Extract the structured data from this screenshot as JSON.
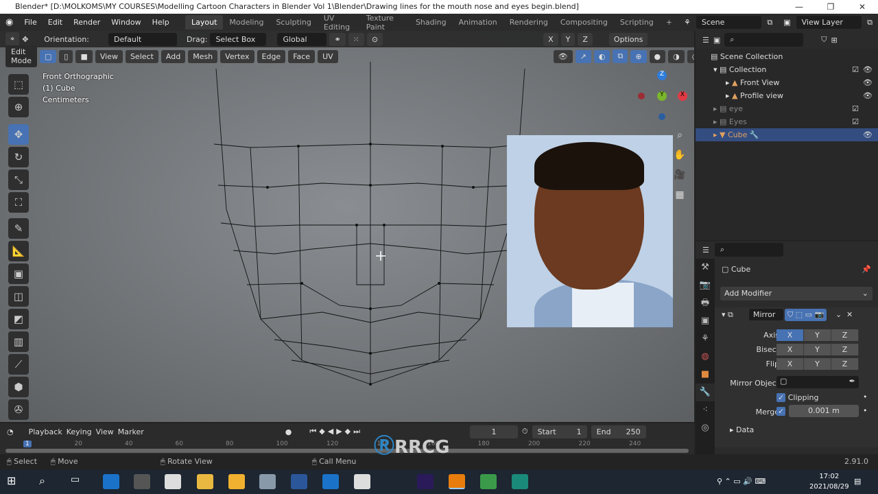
{
  "window": {
    "title": "Blender* [D:\\MOLKOMS\\MY COURSES\\Modelling  Cartoon Characters in Blender Vol 1\\Blender\\Drawing lines for the mouth nose and eyes begin.blend]"
  },
  "menu": [
    "File",
    "Edit",
    "Render",
    "Window",
    "Help"
  ],
  "workspaces": [
    "Layout",
    "Modeling",
    "Sculpting",
    "UV Editing",
    "Texture Paint",
    "Shading",
    "Animation",
    "Rendering",
    "Compositing",
    "Scripting"
  ],
  "scene": "Scene",
  "view_layer": "View Layer",
  "toolsettings": {
    "orientation_label": "Orientation:",
    "orientation": "Default",
    "drag_label": "Drag:",
    "drag": "Select Box",
    "transform": "Global",
    "options": "Options",
    "axes": [
      "X",
      "Y",
      "Z"
    ]
  },
  "header": {
    "mode": "Edit Mode",
    "menus": [
      "View",
      "Select",
      "Add",
      "Mesh",
      "Vertex",
      "Edge",
      "Face",
      "UV"
    ]
  },
  "viewport": {
    "view_name": "Front Orthographic",
    "object": "(1) Cube",
    "units": "Centimeters",
    "gizmo": {
      "z": "Z",
      "y": "Y",
      "x": "X"
    }
  },
  "outliner": {
    "rows": [
      {
        "label": "Scene Collection",
        "indent": 0
      },
      {
        "label": "Collection",
        "indent": 1
      },
      {
        "label": "Front View",
        "indent": 2
      },
      {
        "label": "Profile view",
        "indent": 2
      },
      {
        "label": "eye",
        "indent": 1
      },
      {
        "label": "Eyes",
        "indent": 1
      },
      {
        "label": "Cube",
        "indent": 1,
        "selected": true
      }
    ]
  },
  "properties": {
    "object": "Cube",
    "add_modifier": "Add Modifier",
    "modifier": "Mirror",
    "axis_label": "Axis",
    "bisect_label": "Bisect",
    "flip_label": "Flip",
    "xyz": [
      "X",
      "Y",
      "Z"
    ],
    "axis_active": "X",
    "mirror_object_label": "Mirror Object",
    "clipping_label": "Clipping",
    "clipping": true,
    "merge_label": "Merge",
    "merge": true,
    "merge_value": "0.001 m",
    "data_label": "Data"
  },
  "timeline": {
    "menus": [
      "Playback",
      "Keying",
      "View",
      "Marker"
    ],
    "current_frame": "1",
    "start_label": "Start",
    "start": "1",
    "end_label": "End",
    "end": "250",
    "ticks": [
      "1",
      "20",
      "40",
      "60",
      "80",
      "100",
      "120",
      "140",
      "160",
      "180",
      "200",
      "220",
      "240"
    ]
  },
  "status": {
    "select": "Select",
    "move": "Move",
    "rotate": "Rotate View",
    "menu": "Call Menu",
    "version": "2.91.0"
  },
  "taskbar": {
    "time": "17:02",
    "date": "2021/08/29"
  },
  "watermark": "RRCG 人人素材",
  "colors": {
    "accent": "#4772b3",
    "selected_row": "#334d80"
  }
}
